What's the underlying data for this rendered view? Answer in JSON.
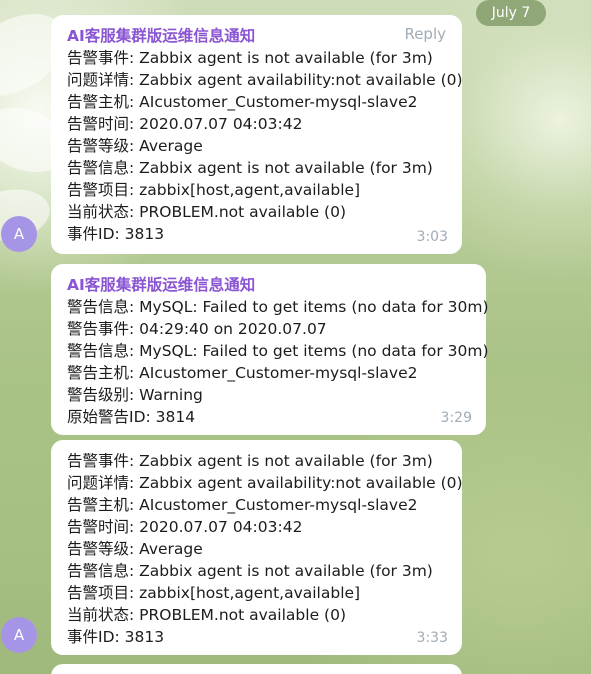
{
  "date_badge": "July 7",
  "messages": [
    {
      "sender": "AI客服集群版运维信息通知",
      "reply_label": "Reply",
      "lines": [
        "告警事件: Zabbix agent is not available (for 3m)",
        "问题详情:  Zabbix agent availability:not available (0)",
        "告警主机:  AIcustomer_Customer-mysql-slave2",
        "告警时间:  2020.07.07 04:03:42",
        "告警等级:  Average",
        "告警信息:  Zabbix agent is not available (for 3m)",
        "告警项目:  zabbix[host,agent,available]",
        "当前状态:  PROBLEM.not available (0)",
        "事件ID:  3813"
      ],
      "time": "3:03",
      "avatar": "A"
    },
    {
      "sender": "AI客服集群版运维信息通知",
      "lines": [
        "警告信息: MySQL: Failed to get items (no data for 30m)",
        "警告事件: 04:29:40 on 2020.07.07",
        "警告信息: MySQL: Failed to get items (no data for 30m)",
        "警告主机: AIcustomer_Customer-mysql-slave2",
        "警告级别: Warning",
        "原始警告ID: 3814"
      ],
      "time": "3:29"
    },
    {
      "lines": [
        "告警事件: Zabbix agent is not available (for 3m)",
        "问题详情:  Zabbix agent availability:not available (0)",
        "告警主机:  AIcustomer_Customer-mysql-slave2",
        "告警时间:  2020.07.07 04:03:42",
        "告警等级:  Average",
        "告警信息:  Zabbix agent is not available (for 3m)",
        "告警项目:  zabbix[host,agent,available]",
        "当前状态:  PROBLEM.not available (0)",
        "事件ID:  3813"
      ],
      "time": "3:33",
      "avatar": "A"
    }
  ]
}
